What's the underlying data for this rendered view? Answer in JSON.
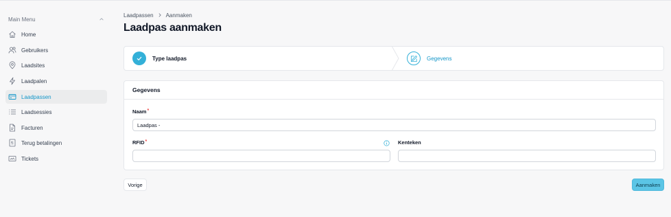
{
  "sidebar": {
    "header": "Main Menu",
    "items": [
      {
        "label": "Home",
        "icon": "home-icon"
      },
      {
        "label": "Gebruikers",
        "icon": "users-icon"
      },
      {
        "label": "Laadsites",
        "icon": "location-pin-icon"
      },
      {
        "label": "Laadpalen",
        "icon": "lightning-icon"
      },
      {
        "label": "Laadpassen",
        "icon": "card-icon",
        "active": true
      },
      {
        "label": "Laadsessies",
        "icon": "list-icon"
      },
      {
        "label": "Facturen",
        "icon": "document-icon"
      },
      {
        "label": "Terug betalingen",
        "icon": "refund-icon"
      },
      {
        "label": "Tickets",
        "icon": "ticket-icon"
      }
    ]
  },
  "breadcrumb": [
    "Laadpassen",
    "Aanmaken"
  ],
  "page_title": "Laadpas aanmaken",
  "stepper": {
    "steps": [
      {
        "label": "Type laadpas",
        "state": "completed",
        "icon": "check-icon"
      },
      {
        "label": "Gegevens",
        "state": "current",
        "icon": "edit-icon"
      }
    ]
  },
  "form": {
    "title": "Gegevens",
    "name_label": "Naam",
    "name_value": "Laadpas - ",
    "rfid_label": "RFID",
    "rfid_value": "",
    "plate_label": "Kenteken",
    "plate_value": "",
    "required_mark": "*"
  },
  "buttons": {
    "back": "Vorige",
    "create": "Aanmaken"
  },
  "colors": {
    "accent": "#33b0d8",
    "accent_text": "#1597c9",
    "required": "#ef4444",
    "primary_button": "#5bc5e6"
  }
}
